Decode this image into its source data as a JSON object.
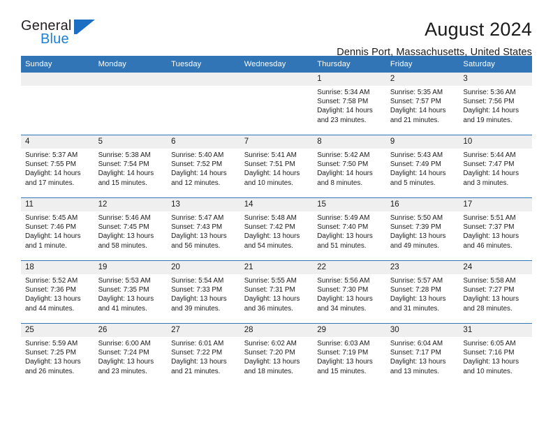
{
  "logo": {
    "word_one": "General",
    "word_two": "Blue",
    "mark": "triangle-mark",
    "color_dark": "#231f20",
    "color_blue": "#1b7fd4"
  },
  "header": {
    "title": "August 2024",
    "subtitle": "Dennis Port, Massachusetts, United States"
  },
  "theme": {
    "header_blue": "#3175b6",
    "daynum_band": "#efefef",
    "text": "#1a1a1a"
  },
  "weekdays": [
    "Sunday",
    "Monday",
    "Tuesday",
    "Wednesday",
    "Thursday",
    "Friday",
    "Saturday"
  ],
  "weeks": [
    [
      {
        "day": "",
        "empty": true
      },
      {
        "day": "",
        "empty": true
      },
      {
        "day": "",
        "empty": true
      },
      {
        "day": "",
        "empty": true
      },
      {
        "day": "1",
        "sunrise": "Sunrise: 5:34 AM",
        "sunset": "Sunset: 7:58 PM",
        "daylight_1": "Daylight: 14 hours",
        "daylight_2": "and 23 minutes."
      },
      {
        "day": "2",
        "sunrise": "Sunrise: 5:35 AM",
        "sunset": "Sunset: 7:57 PM",
        "daylight_1": "Daylight: 14 hours",
        "daylight_2": "and 21 minutes."
      },
      {
        "day": "3",
        "sunrise": "Sunrise: 5:36 AM",
        "sunset": "Sunset: 7:56 PM",
        "daylight_1": "Daylight: 14 hours",
        "daylight_2": "and 19 minutes."
      }
    ],
    [
      {
        "day": "4",
        "sunrise": "Sunrise: 5:37 AM",
        "sunset": "Sunset: 7:55 PM",
        "daylight_1": "Daylight: 14 hours",
        "daylight_2": "and 17 minutes."
      },
      {
        "day": "5",
        "sunrise": "Sunrise: 5:38 AM",
        "sunset": "Sunset: 7:54 PM",
        "daylight_1": "Daylight: 14 hours",
        "daylight_2": "and 15 minutes."
      },
      {
        "day": "6",
        "sunrise": "Sunrise: 5:40 AM",
        "sunset": "Sunset: 7:52 PM",
        "daylight_1": "Daylight: 14 hours",
        "daylight_2": "and 12 minutes."
      },
      {
        "day": "7",
        "sunrise": "Sunrise: 5:41 AM",
        "sunset": "Sunset: 7:51 PM",
        "daylight_1": "Daylight: 14 hours",
        "daylight_2": "and 10 minutes."
      },
      {
        "day": "8",
        "sunrise": "Sunrise: 5:42 AM",
        "sunset": "Sunset: 7:50 PM",
        "daylight_1": "Daylight: 14 hours",
        "daylight_2": "and 8 minutes."
      },
      {
        "day": "9",
        "sunrise": "Sunrise: 5:43 AM",
        "sunset": "Sunset: 7:49 PM",
        "daylight_1": "Daylight: 14 hours",
        "daylight_2": "and 5 minutes."
      },
      {
        "day": "10",
        "sunrise": "Sunrise: 5:44 AM",
        "sunset": "Sunset: 7:47 PM",
        "daylight_1": "Daylight: 14 hours",
        "daylight_2": "and 3 minutes."
      }
    ],
    [
      {
        "day": "11",
        "sunrise": "Sunrise: 5:45 AM",
        "sunset": "Sunset: 7:46 PM",
        "daylight_1": "Daylight: 14 hours",
        "daylight_2": "and 1 minute."
      },
      {
        "day": "12",
        "sunrise": "Sunrise: 5:46 AM",
        "sunset": "Sunset: 7:45 PM",
        "daylight_1": "Daylight: 13 hours",
        "daylight_2": "and 58 minutes."
      },
      {
        "day": "13",
        "sunrise": "Sunrise: 5:47 AM",
        "sunset": "Sunset: 7:43 PM",
        "daylight_1": "Daylight: 13 hours",
        "daylight_2": "and 56 minutes."
      },
      {
        "day": "14",
        "sunrise": "Sunrise: 5:48 AM",
        "sunset": "Sunset: 7:42 PM",
        "daylight_1": "Daylight: 13 hours",
        "daylight_2": "and 54 minutes."
      },
      {
        "day": "15",
        "sunrise": "Sunrise: 5:49 AM",
        "sunset": "Sunset: 7:40 PM",
        "daylight_1": "Daylight: 13 hours",
        "daylight_2": "and 51 minutes."
      },
      {
        "day": "16",
        "sunrise": "Sunrise: 5:50 AM",
        "sunset": "Sunset: 7:39 PM",
        "daylight_1": "Daylight: 13 hours",
        "daylight_2": "and 49 minutes."
      },
      {
        "day": "17",
        "sunrise": "Sunrise: 5:51 AM",
        "sunset": "Sunset: 7:37 PM",
        "daylight_1": "Daylight: 13 hours",
        "daylight_2": "and 46 minutes."
      }
    ],
    [
      {
        "day": "18",
        "sunrise": "Sunrise: 5:52 AM",
        "sunset": "Sunset: 7:36 PM",
        "daylight_1": "Daylight: 13 hours",
        "daylight_2": "and 44 minutes."
      },
      {
        "day": "19",
        "sunrise": "Sunrise: 5:53 AM",
        "sunset": "Sunset: 7:35 PM",
        "daylight_1": "Daylight: 13 hours",
        "daylight_2": "and 41 minutes."
      },
      {
        "day": "20",
        "sunrise": "Sunrise: 5:54 AM",
        "sunset": "Sunset: 7:33 PM",
        "daylight_1": "Daylight: 13 hours",
        "daylight_2": "and 39 minutes."
      },
      {
        "day": "21",
        "sunrise": "Sunrise: 5:55 AM",
        "sunset": "Sunset: 7:31 PM",
        "daylight_1": "Daylight: 13 hours",
        "daylight_2": "and 36 minutes."
      },
      {
        "day": "22",
        "sunrise": "Sunrise: 5:56 AM",
        "sunset": "Sunset: 7:30 PM",
        "daylight_1": "Daylight: 13 hours",
        "daylight_2": "and 34 minutes."
      },
      {
        "day": "23",
        "sunrise": "Sunrise: 5:57 AM",
        "sunset": "Sunset: 7:28 PM",
        "daylight_1": "Daylight: 13 hours",
        "daylight_2": "and 31 minutes."
      },
      {
        "day": "24",
        "sunrise": "Sunrise: 5:58 AM",
        "sunset": "Sunset: 7:27 PM",
        "daylight_1": "Daylight: 13 hours",
        "daylight_2": "and 28 minutes."
      }
    ],
    [
      {
        "day": "25",
        "sunrise": "Sunrise: 5:59 AM",
        "sunset": "Sunset: 7:25 PM",
        "daylight_1": "Daylight: 13 hours",
        "daylight_2": "and 26 minutes."
      },
      {
        "day": "26",
        "sunrise": "Sunrise: 6:00 AM",
        "sunset": "Sunset: 7:24 PM",
        "daylight_1": "Daylight: 13 hours",
        "daylight_2": "and 23 minutes."
      },
      {
        "day": "27",
        "sunrise": "Sunrise: 6:01 AM",
        "sunset": "Sunset: 7:22 PM",
        "daylight_1": "Daylight: 13 hours",
        "daylight_2": "and 21 minutes."
      },
      {
        "day": "28",
        "sunrise": "Sunrise: 6:02 AM",
        "sunset": "Sunset: 7:20 PM",
        "daylight_1": "Daylight: 13 hours",
        "daylight_2": "and 18 minutes."
      },
      {
        "day": "29",
        "sunrise": "Sunrise: 6:03 AM",
        "sunset": "Sunset: 7:19 PM",
        "daylight_1": "Daylight: 13 hours",
        "daylight_2": "and 15 minutes."
      },
      {
        "day": "30",
        "sunrise": "Sunrise: 6:04 AM",
        "sunset": "Sunset: 7:17 PM",
        "daylight_1": "Daylight: 13 hours",
        "daylight_2": "and 13 minutes."
      },
      {
        "day": "31",
        "sunrise": "Sunrise: 6:05 AM",
        "sunset": "Sunset: 7:16 PM",
        "daylight_1": "Daylight: 13 hours",
        "daylight_2": "and 10 minutes."
      }
    ]
  ]
}
